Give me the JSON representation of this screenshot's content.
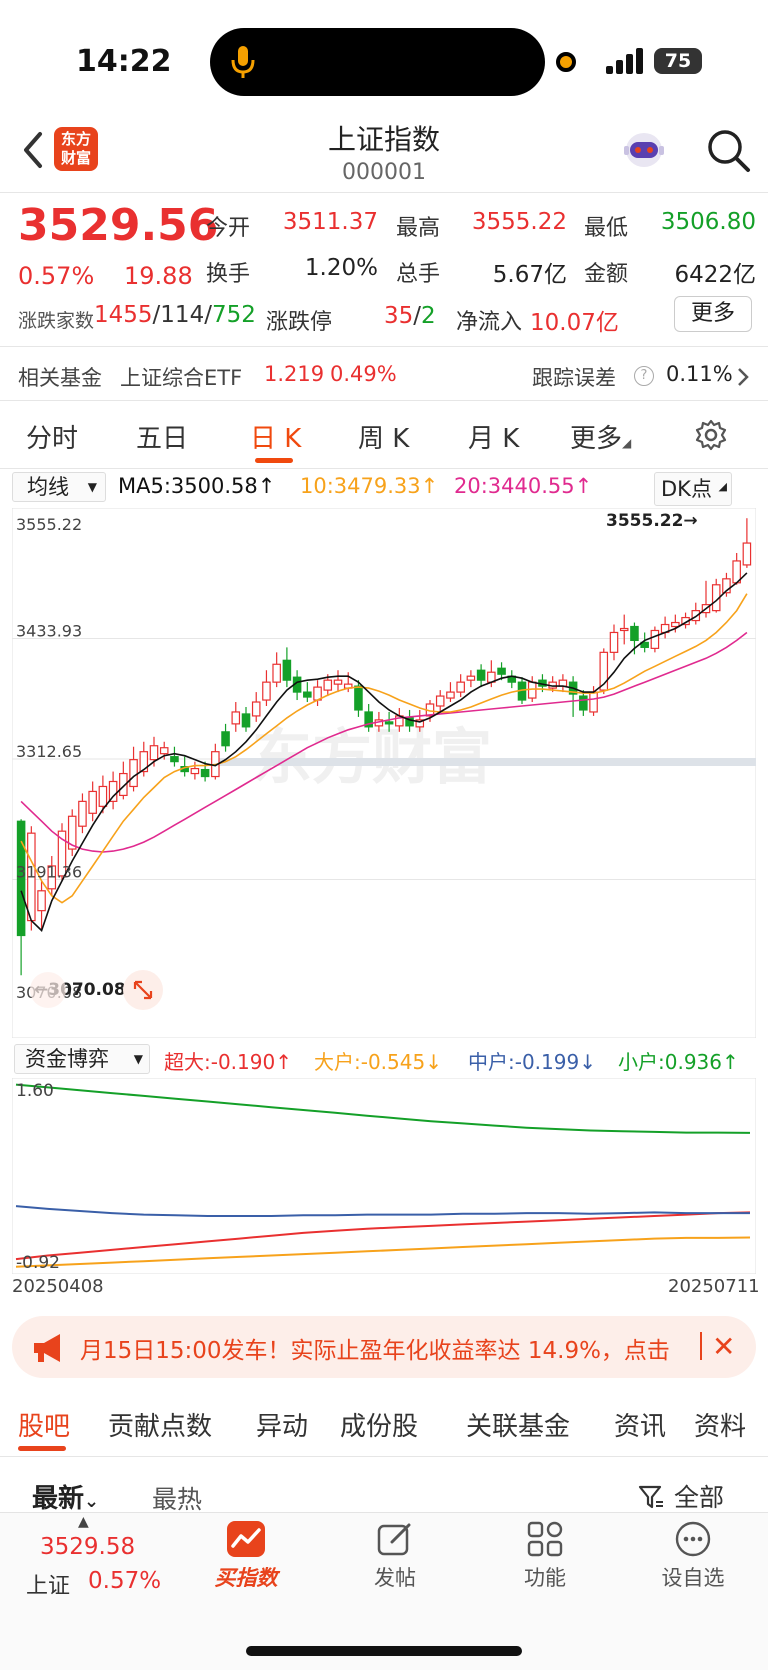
{
  "status_bar": {
    "time": "14:22",
    "battery": "75"
  },
  "header": {
    "title": "上证指数",
    "code": "000001",
    "logo_text": "东方财富"
  },
  "quote": {
    "price": "3529.56",
    "change_pct": "0.57%",
    "change": "19.88",
    "open_label": "今开",
    "open": "3511.37",
    "high_label": "最高",
    "high": "3555.22",
    "low_label": "最低",
    "low": "3506.80",
    "turnover_label": "换手",
    "turnover": "1.20%",
    "volume_label": "总手",
    "volume": "5.67亿",
    "amount_label": "金额",
    "amount": "6422亿",
    "breadth_label": "涨跌家数",
    "breadth_up": "1455",
    "breadth_flat": "114",
    "breadth_down": "752",
    "limit_label": "涨跌停",
    "limit_up": "35",
    "limit_down": "2",
    "netflow_label": "净流入",
    "netflow": "10.07亿",
    "more_button": "更多"
  },
  "fund_row": {
    "label": "相关基金",
    "fund_name": "上证综合ETF",
    "fund_price": "1.219",
    "fund_pct": "0.49%",
    "tracking_label": "跟踪误差",
    "tracking_value": "0.11%"
  },
  "chart_tabs": [
    "分时",
    "五日",
    "日 K",
    "周 K",
    "月 K",
    "更多"
  ],
  "ma_row": {
    "select": "均线",
    "ma5": "MA5:3500.58",
    "ma10": "10:3479.33",
    "ma20": "20:3440.55",
    "dk_select": "DK点"
  },
  "colors": {
    "up": "#e93030",
    "down": "#14a028",
    "ma5": "#111111",
    "ma10": "#f7a21b",
    "ma20": "#e02a8f",
    "accent": "#e8431c"
  },
  "chart_data": [
    {
      "type": "candlestick",
      "y_ticks": [
        "3555.22",
        "3433.93",
        "3312.65",
        "3191.36",
        "3070.08"
      ],
      "ylim": [
        3070.08,
        3555.22
      ],
      "high_marker": "3555.22→",
      "low_marker": "←3070.08",
      "candles": [
        [
          3250,
          3135,
          3252,
          3095
        ],
        [
          3150,
          3238,
          3245,
          3140
        ],
        [
          3160,
          3180,
          3190,
          3140
        ],
        [
          3182,
          3205,
          3215,
          3175
        ],
        [
          3195,
          3240,
          3248,
          3190
        ],
        [
          3222,
          3255,
          3262,
          3215
        ],
        [
          3245,
          3270,
          3278,
          3238
        ],
        [
          3258,
          3280,
          3290,
          3250
        ],
        [
          3265,
          3285,
          3296,
          3258
        ],
        [
          3270,
          3290,
          3300,
          3262
        ],
        [
          3276,
          3298,
          3310,
          3272
        ],
        [
          3285,
          3312,
          3325,
          3280
        ],
        [
          3300,
          3320,
          3330,
          3295
        ],
        [
          3312,
          3326,
          3335,
          3305
        ],
        [
          3318,
          3324,
          3330,
          3312
        ],
        [
          3315,
          3310,
          3325,
          3305
        ],
        [
          3305,
          3300,
          3315,
          3295
        ],
        [
          3298,
          3303,
          3310,
          3292
        ],
        [
          3302,
          3295,
          3310,
          3290
        ],
        [
          3295,
          3320,
          3328,
          3292
        ],
        [
          3340,
          3326,
          3348,
          3320
        ],
        [
          3348,
          3360,
          3370,
          3340
        ],
        [
          3358,
          3345,
          3365,
          3340
        ],
        [
          3356,
          3370,
          3380,
          3350
        ],
        [
          3372,
          3390,
          3402,
          3366
        ],
        [
          3390,
          3408,
          3420,
          3385
        ],
        [
          3412,
          3392,
          3425,
          3385
        ],
        [
          3395,
          3380,
          3402,
          3372
        ],
        [
          3380,
          3375,
          3390,
          3370
        ],
        [
          3372,
          3385,
          3392,
          3366
        ],
        [
          3382,
          3392,
          3398,
          3376
        ],
        [
          3388,
          3392,
          3402,
          3380
        ],
        [
          3384,
          3388,
          3400,
          3380
        ],
        [
          3386,
          3362,
          3392,
          3355
        ],
        [
          3360,
          3345,
          3368,
          3340
        ],
        [
          3346,
          3352,
          3360,
          3340
        ],
        [
          3350,
          3348,
          3360,
          3340
        ],
        [
          3346,
          3356,
          3364,
          3340
        ],
        [
          3354,
          3346,
          3362,
          3340
        ],
        [
          3345,
          3352,
          3362,
          3340
        ],
        [
          3356,
          3368,
          3372,
          3350
        ],
        [
          3366,
          3376,
          3382,
          3360
        ],
        [
          3374,
          3380,
          3390,
          3370
        ],
        [
          3380,
          3390,
          3398,
          3375
        ],
        [
          3392,
          3396,
          3402,
          3385
        ],
        [
          3402,
          3392,
          3408,
          3385
        ],
        [
          3390,
          3400,
          3412,
          3385
        ],
        [
          3404,
          3398,
          3410,
          3392
        ],
        [
          3396,
          3390,
          3402,
          3384
        ],
        [
          3390,
          3372,
          3395,
          3368
        ],
        [
          3374,
          3390,
          3396,
          3370
        ],
        [
          3392,
          3386,
          3398,
          3380
        ],
        [
          3384,
          3390,
          3396,
          3380
        ],
        [
          3386,
          3392,
          3398,
          3380
        ],
        [
          3390,
          3378,
          3396,
          3355
        ],
        [
          3376,
          3362,
          3382,
          3356
        ],
        [
          3360,
          3380,
          3386,
          3356
        ],
        [
          3382,
          3420,
          3424,
          3378
        ],
        [
          3420,
          3440,
          3448,
          3412
        ],
        [
          3442,
          3444,
          3458,
          3428
        ],
        [
          3446,
          3432,
          3450,
          3418
        ],
        [
          3430,
          3425,
          3440,
          3420
        ],
        [
          3424,
          3442,
          3446,
          3420
        ],
        [
          3440,
          3448,
          3456,
          3434
        ],
        [
          3446,
          3450,
          3458,
          3440
        ],
        [
          3448,
          3455,
          3460,
          3444
        ],
        [
          3452,
          3462,
          3470,
          3448
        ],
        [
          3460,
          3468,
          3492,
          3455
        ],
        [
          3462,
          3488,
          3494,
          3460
        ],
        [
          3480,
          3494,
          3500,
          3476
        ],
        [
          3490,
          3512,
          3520,
          3488
        ],
        [
          3508,
          3530,
          3555,
          3505
        ]
      ],
      "ma5": [
        3180,
        3150,
        3140,
        3170,
        3190,
        3210,
        3228,
        3246,
        3262,
        3275,
        3285,
        3295,
        3302,
        3310,
        3316,
        3318,
        3316,
        3312,
        3308,
        3306,
        3312,
        3320,
        3330,
        3342,
        3356,
        3370,
        3382,
        3390,
        3392,
        3393,
        3395,
        3396,
        3396,
        3390,
        3380,
        3370,
        3362,
        3356,
        3352,
        3350,
        3354,
        3360,
        3366,
        3372,
        3380,
        3386,
        3390,
        3394,
        3396,
        3394,
        3390,
        3388,
        3386,
        3386,
        3384,
        3380,
        3380,
        3388,
        3400,
        3414,
        3424,
        3432,
        3436,
        3440,
        3444,
        3450,
        3456,
        3464,
        3472,
        3482,
        3490,
        3500
      ],
      "ma10": [
        3230,
        3210,
        3190,
        3175,
        3168,
        3175,
        3190,
        3205,
        3220,
        3235,
        3250,
        3262,
        3274,
        3284,
        3294,
        3300,
        3304,
        3306,
        3306,
        3307,
        3310,
        3315,
        3322,
        3330,
        3338,
        3346,
        3354,
        3361,
        3367,
        3372,
        3377,
        3381,
        3384,
        3385,
        3384,
        3381,
        3377,
        3372,
        3368,
        3364,
        3361,
        3360,
        3360,
        3362,
        3365,
        3369,
        3373,
        3377,
        3380,
        3382,
        3383,
        3383,
        3382,
        3381,
        3380,
        3379,
        3379,
        3381,
        3384,
        3389,
        3395,
        3401,
        3406,
        3411,
        3416,
        3421,
        3426,
        3432,
        3440,
        3450,
        3462,
        3479
      ],
      "ma20": [
        3270,
        3260,
        3250,
        3240,
        3232,
        3226,
        3222,
        3220,
        3219,
        3220,
        3222,
        3225,
        3229,
        3234,
        3240,
        3246,
        3252,
        3258,
        3264,
        3270,
        3276,
        3282,
        3288,
        3294,
        3300,
        3306,
        3312,
        3318,
        3324,
        3329,
        3334,
        3338,
        3342,
        3345,
        3348,
        3350,
        3352,
        3354,
        3355,
        3356,
        3357,
        3358,
        3359,
        3360,
        3361,
        3362,
        3363,
        3364,
        3365,
        3366,
        3367,
        3368,
        3369,
        3370,
        3371,
        3372,
        3373,
        3375,
        3378,
        3382,
        3386,
        3390,
        3394,
        3398,
        3402,
        3406,
        3410,
        3414,
        3419,
        3425,
        3432,
        3440
      ]
    },
    {
      "type": "line",
      "title": "资金博弈",
      "y_ticks": [
        "1.60",
        "-0.92"
      ],
      "ylim": [
        -0.92,
        1.6
      ],
      "x_labels": [
        "20250408",
        "20250711"
      ],
      "series": [
        {
          "name": "超大",
          "legend": "超大:-0.190",
          "color": "#e93030",
          "values": [
            -0.85,
            -0.8,
            -0.76,
            -0.72,
            -0.68,
            -0.64,
            -0.6,
            -0.56,
            -0.52,
            -0.48,
            -0.45,
            -0.42,
            -0.4,
            -0.38,
            -0.36,
            -0.34,
            -0.32,
            -0.3,
            -0.28,
            -0.26,
            -0.24,
            -0.22,
            -0.2,
            -0.19
          ]
        },
        {
          "name": "大户",
          "legend": "大户:-0.545",
          "color": "#f7a21b",
          "values": [
            -0.96,
            -0.94,
            -0.92,
            -0.9,
            -0.88,
            -0.86,
            -0.84,
            -0.82,
            -0.8,
            -0.78,
            -0.76,
            -0.74,
            -0.72,
            -0.7,
            -0.68,
            -0.66,
            -0.64,
            -0.62,
            -0.6,
            -0.58,
            -0.56,
            -0.55,
            -0.55,
            -0.545
          ]
        },
        {
          "name": "中户",
          "legend": "中户:-0.199",
          "color": "#3a5fa8",
          "values": [
            -0.1,
            -0.14,
            -0.17,
            -0.2,
            -0.22,
            -0.23,
            -0.24,
            -0.24,
            -0.24,
            -0.23,
            -0.23,
            -0.22,
            -0.22,
            -0.22,
            -0.21,
            -0.21,
            -0.2,
            -0.2,
            -0.21,
            -0.2,
            -0.19,
            -0.2,
            -0.2,
            -0.199
          ]
        },
        {
          "name": "小户",
          "legend": "小户:0.936",
          "color": "#14a028",
          "values": [
            1.62,
            1.58,
            1.54,
            1.5,
            1.46,
            1.42,
            1.38,
            1.34,
            1.3,
            1.26,
            1.22,
            1.18,
            1.14,
            1.1,
            1.07,
            1.04,
            1.01,
            0.99,
            0.97,
            0.96,
            0.95,
            0.94,
            0.94,
            0.936
          ]
        }
      ]
    }
  ],
  "banner": {
    "text": "月15日15:00发车！实际止盈年化收益率达 14.9%，点击"
  },
  "feed_tabs": [
    "股吧",
    "贡献点数",
    "异动",
    "成份股",
    "关联基金",
    "资讯",
    "资料"
  ],
  "feed_sort": {
    "newest": "最新",
    "hottest": "最热",
    "filter": "全部"
  },
  "bottom_nav": {
    "quote_price": "3529.58",
    "quote_name": "上证",
    "quote_pct": "0.57%",
    "items": [
      "买指数",
      "发帖",
      "功能",
      "设自选"
    ]
  }
}
